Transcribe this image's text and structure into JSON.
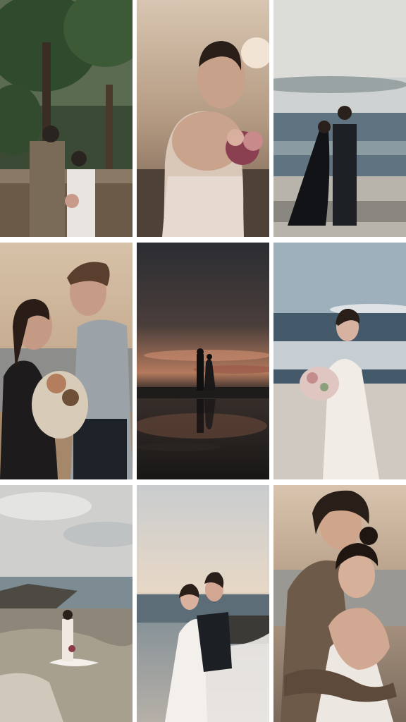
{
  "gallery": {
    "photos": [
      {
        "subject": "couple-forest"
      },
      {
        "subject": "bride-bouquet-sunset"
      },
      {
        "subject": "couple-sea-rocks"
      },
      {
        "subject": "couple-facing-bouquet"
      },
      {
        "subject": "silhouette-reflection"
      },
      {
        "subject": "bride-ocean-bouquet"
      },
      {
        "subject": "bride-seated-rocks"
      },
      {
        "subject": "couple-veil-beach"
      },
      {
        "subject": "couple-embrace"
      }
    ]
  },
  "colors": {
    "background": "#ffffff",
    "sunset": "#c9a98e",
    "sea": "#5f7480",
    "dusk": "#2b2d33"
  }
}
